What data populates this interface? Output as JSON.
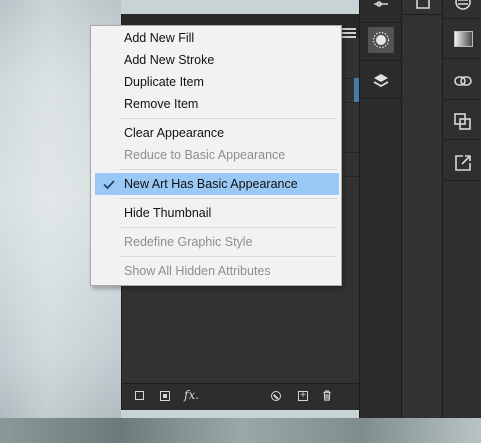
{
  "menu": {
    "items": [
      {
        "label": "Add New Fill",
        "enabled": true
      },
      {
        "label": "Add New Stroke",
        "enabled": true
      },
      {
        "label": "Duplicate Item",
        "enabled": true
      },
      {
        "label": "Remove Item",
        "enabled": true
      },
      {
        "label": "Clear Appearance",
        "enabled": true
      },
      {
        "label": "Reduce to Basic Appearance",
        "enabled": false
      },
      {
        "label": "New Art Has Basic Appearance",
        "enabled": true,
        "checked": true,
        "highlighted": true
      },
      {
        "label": "Hide Thumbnail",
        "enabled": true
      },
      {
        "label": "Redefine Graphic Style",
        "enabled": false
      },
      {
        "label": "Show All Hidden Attributes",
        "enabled": false
      }
    ]
  },
  "panel": {
    "footer_fx_label": "fx."
  },
  "dock_icons": {
    "column1": [
      "properties-sliders-icon",
      "appearance-sun-icon",
      "layers-icon"
    ],
    "column3": [
      "color-wheel-icon",
      "gradient-icon",
      "links-icon",
      "pathfinder-icon",
      "export-icon"
    ]
  },
  "colors": {
    "menu_highlight": "#99c9f4",
    "panel_bg": "#323232",
    "dock_bg": "#2b2b2b"
  }
}
